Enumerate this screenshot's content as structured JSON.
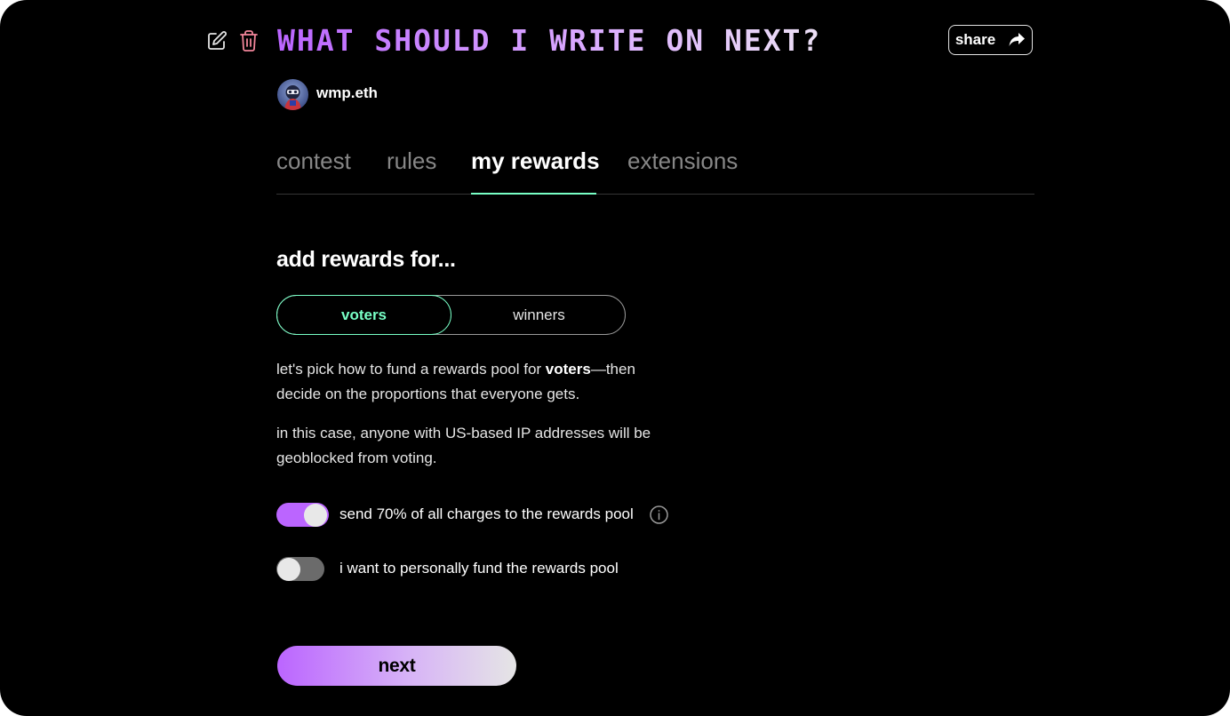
{
  "header": {
    "title": "WHAT SHOULD I WRITE ON NEXT?",
    "edit_icon": "pencil-edit-icon",
    "delete_icon": "trash-icon",
    "share_label": "share",
    "share_icon": "share-arrow-icon"
  },
  "creator": {
    "username": "wmp.eth",
    "avatar_icon": "avatar-image"
  },
  "tabs": [
    {
      "label": "contest",
      "active": false
    },
    {
      "label": "rules",
      "active": false
    },
    {
      "label": "my rewards",
      "active": true
    },
    {
      "label": "extensions",
      "active": false
    }
  ],
  "rewards": {
    "heading": "add rewards for...",
    "options": [
      {
        "label": "voters",
        "selected": true
      },
      {
        "label": "winners",
        "selected": false
      }
    ],
    "intro_before": "let's pick how to fund a rewards pool for ",
    "intro_bold": "voters",
    "intro_after": "—then decide on the proportions that everyone gets.",
    "geoblock_note": "in this case, anyone with US-based IP addresses will be geoblocked from voting.",
    "toggles": [
      {
        "label": "send 70% of all charges to the rewards pool",
        "on": true,
        "info_icon": "info-circle-icon"
      },
      {
        "label": "i want to personally fund the rewards pool",
        "on": false
      }
    ],
    "next_label": "next"
  },
  "colors": {
    "background": "#000000",
    "accent_green": "#78ffc6",
    "accent_purple": "#bb65ff",
    "toggle_off": "#6b6b6b",
    "text_muted": "#878787"
  }
}
